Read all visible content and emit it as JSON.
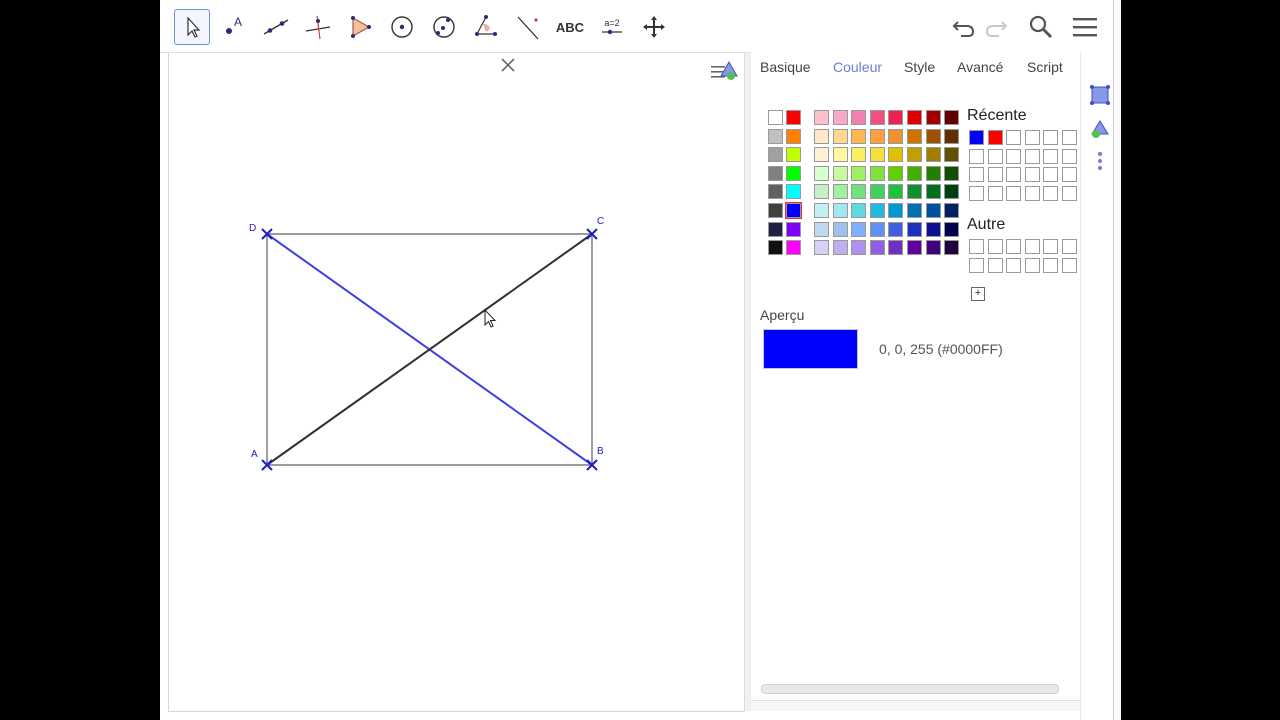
{
  "toolbar": {
    "tools": [
      {
        "name": "move-tool",
        "icon": "cursor-arrow-icon"
      },
      {
        "name": "point-tool",
        "icon": "point-a-icon",
        "text": "A"
      },
      {
        "name": "line-tool",
        "icon": "line-through-points-icon"
      },
      {
        "name": "perpendicular-tool",
        "icon": "perpendicular-line-icon"
      },
      {
        "name": "polygon-tool",
        "icon": "polygon-icon"
      },
      {
        "name": "circle-tool",
        "icon": "circle-center-icon"
      },
      {
        "name": "conic-tool",
        "icon": "circle-three-points-icon"
      },
      {
        "name": "angle-tool",
        "icon": "angle-icon"
      },
      {
        "name": "reflect-tool",
        "icon": "reflect-line-icon"
      },
      {
        "name": "text-tool",
        "icon": "text-icon",
        "text": "ABC"
      },
      {
        "name": "slider-tool",
        "icon": "slider-icon",
        "text": "a=2"
      },
      {
        "name": "move-view-tool",
        "icon": "move-graphics-view-icon"
      }
    ],
    "undo_icon": "undo-icon",
    "redo_icon": "redo-icon",
    "search_icon": "search-icon",
    "menu_icon": "hamburger-menu-icon"
  },
  "graphics": {
    "points": {
      "A": "A",
      "B": "B",
      "C": "C",
      "D": "D"
    },
    "segment_color": "#606060",
    "diagonal_bd_color": "#4040e0",
    "diagonal_ac_color": "#303030",
    "point_color": "#2020c0"
  },
  "properties": {
    "tabs": [
      "Basique",
      "Couleur",
      "Style",
      "Avancé",
      "Script"
    ],
    "active_tab": "Couleur",
    "recent_label": "Récente",
    "other_label": "Autre",
    "add_label": "+",
    "apercu_label": "Aperçu",
    "preview_color": "#0000FF",
    "preview_value": "0, 0, 255 (#0000FF)",
    "recent_colors": [
      "#0000FF",
      "#FF0000"
    ],
    "gray_column": [
      "#FFFFFF",
      "#C0C0C0",
      "#A0A0A0",
      "#808080",
      "#606060",
      "#404040",
      "#202040",
      "#101010"
    ],
    "primary_column": [
      "#FF0000",
      "#FF8000",
      "#C0FF00",
      "#00FF00",
      "#00FFFF",
      "#0000FF",
      "#8000FF",
      "#FF00FF"
    ],
    "palette": [
      [
        "#FFC0CB",
        "#F8A8C8",
        "#F080B0",
        "#F05080",
        "#F02050",
        "#E00000",
        "#A00000",
        "#600000"
      ],
      [
        "#FFE8C8",
        "#FFD890",
        "#FFB850",
        "#FFA040",
        "#F09030",
        "#D07000",
        "#A05000",
        "#603000"
      ],
      [
        "#FFF0D8",
        "#FFF8A0",
        "#F8F060",
        "#F0E040",
        "#E0C000",
        "#C0A000",
        "#A08000",
        "#605000"
      ],
      [
        "#D8FFD0",
        "#C8F8A0",
        "#A0F060",
        "#80E040",
        "#60D000",
        "#40B000",
        "#208000",
        "#105000"
      ],
      [
        "#C8F0C8",
        "#A0F0A0",
        "#70E080",
        "#40D060",
        "#20C040",
        "#109030",
        "#007020",
        "#004010"
      ],
      [
        "#C0F0F0",
        "#A0E8F0",
        "#60D8E0",
        "#20B8E0",
        "#0098D0",
        "#0070B0",
        "#0050A0",
        "#002060"
      ],
      [
        "#C0D8F0",
        "#A0C0F0",
        "#80B0F8",
        "#6090F0",
        "#4060E0",
        "#2030C0",
        "#101090",
        "#000050"
      ],
      [
        "#D8D0F8",
        "#C0B0F0",
        "#B090F0",
        "#9060E0",
        "#7030C0",
        "#6000A0",
        "#400080",
        "#200040"
      ]
    ]
  }
}
